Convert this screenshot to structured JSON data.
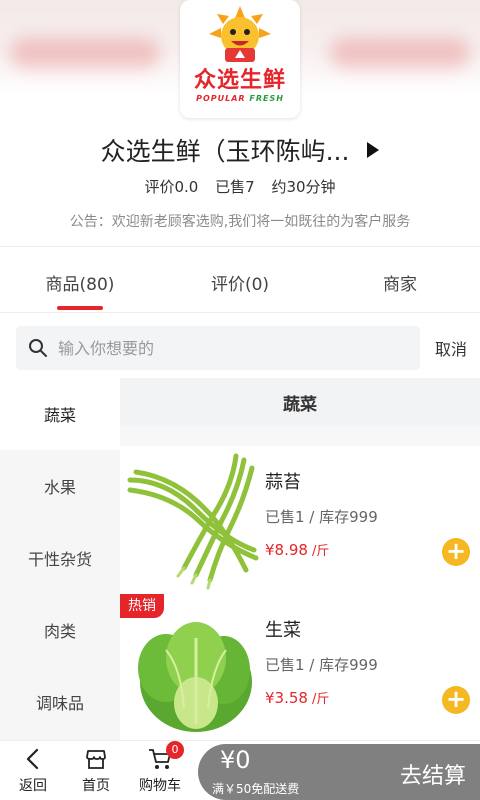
{
  "store": {
    "logo_text": "众选生鲜",
    "logo_en_left": "POPULAR",
    "logo_en_right": "FRESH",
    "name": "众选生鲜（玉环陈屿...",
    "rating": "评价0.0",
    "sold": "已售7",
    "time": "约30分钟",
    "notice": "公告：欢迎新老顾客选购,我们将一如既往的为客户服务"
  },
  "tabs": [
    {
      "label": "商品(80)",
      "active": true
    },
    {
      "label": "评价(0)",
      "active": false
    },
    {
      "label": "商家",
      "active": false
    }
  ],
  "search": {
    "placeholder": "输入你想要的",
    "cancel_label": "取消"
  },
  "categories": [
    "蔬菜",
    "水果",
    "干性杂货",
    "肉类",
    "调味品"
  ],
  "section_title": "蔬菜",
  "products": [
    {
      "name": "蒜苔",
      "sales": "已售1 / 库存999",
      "price": "¥8.98",
      "unit": "/斤",
      "badge": ""
    },
    {
      "name": "生菜",
      "sales": "已售1 / 库存999",
      "price": "¥3.58",
      "unit": "/斤",
      "badge": "热销"
    }
  ],
  "bottom_nav": {
    "back_label": "返回",
    "home_label": "首页",
    "cart_label": "购物车",
    "cart_count": "0"
  },
  "checkout": {
    "amount": "¥0",
    "shipping_note": "满￥50免配送费",
    "button_label": "去结算"
  },
  "colors": {
    "accent": "#e4262b",
    "add_button": "#f4b822",
    "checkout_bg": "#808080"
  }
}
